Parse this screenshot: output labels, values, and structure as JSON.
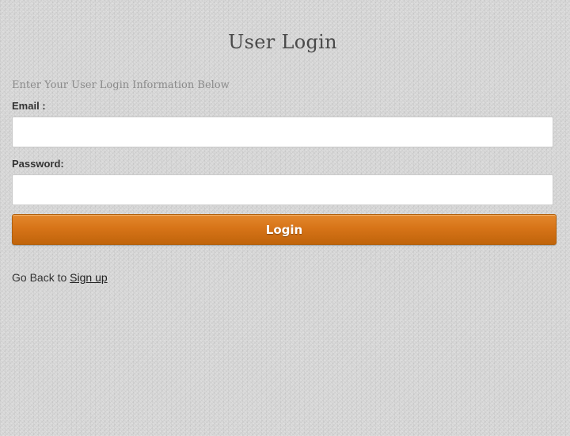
{
  "page": {
    "title": "User Login",
    "instructions": "Enter Your User Login Information Below"
  },
  "form": {
    "email_label": "Email :",
    "email_value": "",
    "email_placeholder": "",
    "password_label": "Password:",
    "password_value": "",
    "password_placeholder": "",
    "login_label": "Login"
  },
  "footer": {
    "back_text": "Go Back to",
    "signup_link": "Sign up"
  },
  "colors": {
    "button_accent": "#d77418",
    "background": "#d6d6d6"
  }
}
